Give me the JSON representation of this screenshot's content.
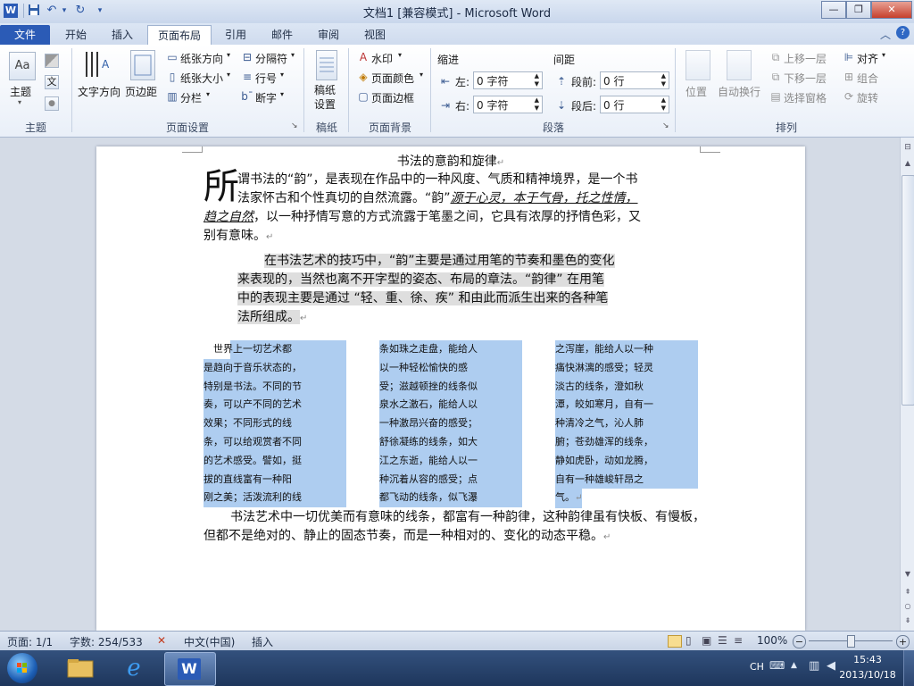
{
  "window": {
    "title": "文档1 [兼容模式] - Microsoft Word",
    "app_icon": "W",
    "controls": {
      "minimize": "—",
      "restore": "❐",
      "close": "✕"
    }
  },
  "qat": {
    "save": "save-icon",
    "undo": "undo-icon",
    "redo": "redo-icon"
  },
  "tabs": [
    {
      "label": "文件"
    },
    {
      "label": "开始"
    },
    {
      "label": "插入"
    },
    {
      "label": "页面布局"
    },
    {
      "label": "引用"
    },
    {
      "label": "邮件"
    },
    {
      "label": "审阅"
    },
    {
      "label": "视图"
    }
  ],
  "ribbon": {
    "theme": {
      "themes": "主题",
      "group": "主题",
      "colors_glyph": "文"
    },
    "page_setup": {
      "text_direction": "文字方向",
      "margins": "页边距",
      "orientation": "纸张方向",
      "size": "纸张大小",
      "columns": "分栏",
      "breaks": "分隔符",
      "line_numbers": "行号",
      "hyphenation": "断字",
      "group": "页面设置"
    },
    "draft": {
      "draft_settings": "稿纸\n设置",
      "group": "稿纸"
    },
    "background": {
      "watermark": "水印",
      "page_color": "页面颜色",
      "page_borders": "页面边框",
      "group": "页面背景"
    },
    "paragraph": {
      "indent_title": "缩进",
      "spacing_title": "间距",
      "left_label": "左:",
      "left_value": "0 字符",
      "right_label": "右:",
      "right_value": "0 字符",
      "before_label": "段前:",
      "before_value": "0 行",
      "after_label": "段后:",
      "after_value": "0 行",
      "group": "段落"
    },
    "arrange": {
      "position": "位置",
      "wrap": "自动换行",
      "bring_forward": "上移一层",
      "send_backward": "下移一层",
      "selection_pane": "选择窗格",
      "align": "对齐",
      "group_btn": "组合",
      "rotate": "旋转",
      "group": "排列"
    }
  },
  "document": {
    "heading": "书法的意韵和旋律",
    "para1": {
      "dropcap": "所",
      "line1": "谓书法的“韵”，是表现在作品中的一种风度、气质和精神境界，是一个书",
      "line2a": "法家怀古和个性真切的自然流露。“韵”",
      "line2b": "源于心灵，本于气骨，托之性情，",
      "line3a": "趋之自然",
      "line3b": "，以一种抒情写意的方式流露于笔墨之间，它具有浓厚的抒情色彩，又",
      "line4": "别有意味。"
    },
    "para2": {
      "line1": "在书法艺术的技巧中，“韵”主要是通过用笔的节奏和墨色的变化",
      "line2": "来表现的，当然也离不开字型的姿态、布局的章法。“韵律” 在用笔",
      "line3": "中的表现主要是通过 “轻、重、徐、疾” 和由此而派生出来的各种笔",
      "line4": "法所组成。"
    },
    "columns": [
      [
        "　世界上一切艺术都",
        "是趋向于音乐状态的，",
        "特别是书法。不同的节",
        "奏，可以产不同的艺术",
        "效果；不同形式的线",
        "条，可以给观赏者不同",
        "的艺术感受。譬如，挺",
        "拔的直线富有一种阳",
        "刚之美；活泼流利的线"
      ],
      [
        "条如珠之走盘，能给人",
        "以一种轻松愉快的感",
        "受；滋越顿挫的线条似",
        "泉水之激石，能给人以",
        "一种激昂兴奋的感受；",
        "舒徐凝练的线条，如大",
        "江之东逝，能给人以一",
        "种沉着从容的感受；点",
        "都飞动的线条，似飞瀑"
      ],
      [
        "之泻崖，能给人以一种",
        "痛快淋漓的感受；轻灵",
        "淡古的线条，澄如秋",
        "潭，皎如寒月，自有一",
        "种清冷之气，沁人肺",
        "腑；苍劲雄浑的线条，",
        "静如虎卧，动如龙腾，",
        "自有一种雄峻轩昂之",
        "气。"
      ]
    ],
    "para3": {
      "line1": "书法艺术中一切优美而有意味的线条，都富有一种韵律，这种韵律虽有快板、有慢板，",
      "line2": "但都不是绝对的、静止的固态节奏，而是一种相对的、变化的动态平稳。"
    }
  },
  "statusbar": {
    "page": "页面: 1/1",
    "words": "字数: 254/533",
    "language": "中文(中国)",
    "mode": "插入",
    "zoom": "100%",
    "zoom_level": 1.0
  },
  "taskbar": {
    "ime": "CH",
    "time": "15:43",
    "date": "2013/10/18"
  }
}
